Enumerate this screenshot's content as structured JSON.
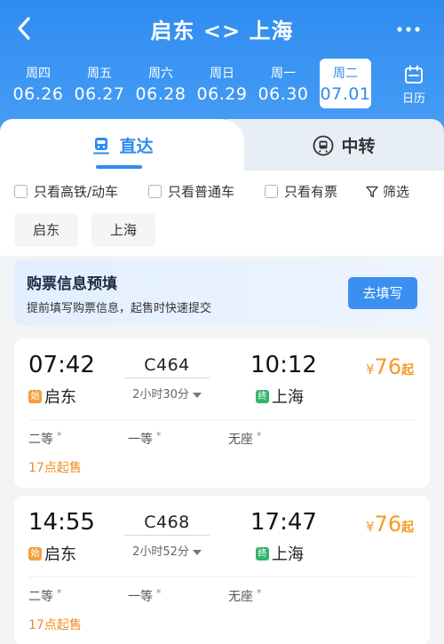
{
  "header": {
    "title": "启东 <> 上海",
    "back_icon": "back-chevron-icon",
    "more_icon": "more-dots-icon",
    "colors": {
      "primary": "#2d8cf0",
      "price": "#f59a23",
      "sale": "#f28a1a"
    }
  },
  "dates": [
    {
      "weekday": "周四",
      "date": "06.26"
    },
    {
      "weekday": "周五",
      "date": "06.27"
    },
    {
      "weekday": "周六",
      "date": "06.28"
    },
    {
      "weekday": "周日",
      "date": "06.29"
    },
    {
      "weekday": "周一",
      "date": "06.30"
    },
    {
      "weekday": "周二",
      "date": "07.01",
      "selected": true
    }
  ],
  "calendar": {
    "label": "日历",
    "icon": "calendar-icon"
  },
  "tabs": [
    {
      "label": "直达",
      "icon": "train-icon",
      "active": true
    },
    {
      "label": "中转",
      "icon": "transfer-train-icon",
      "active": false
    }
  ],
  "filters": {
    "options": [
      {
        "label": "只看高铁/动车",
        "checked": false
      },
      {
        "label": "只看普通车",
        "checked": false
      },
      {
        "label": "只看有票",
        "checked": false
      }
    ],
    "filter_label": "筛选",
    "filter_icon": "funnel-icon"
  },
  "stations": [
    "启东",
    "上海"
  ],
  "prefill": {
    "title": "购票信息预填",
    "desc": "提前填写购票信息，起售时快速提交",
    "button": "去填写"
  },
  "trains": [
    {
      "dep_time": "07:42",
      "arr_time": "10:12",
      "train_no": "C464",
      "duration": "2小时30分",
      "dep_station": "启东",
      "arr_station": "上海",
      "start_tag": "始",
      "end_tag": "终",
      "price_currency": "¥",
      "price": "76",
      "price_unit": "起",
      "seats": [
        "二等",
        "一等",
        "无座"
      ],
      "seat_mark": "*",
      "sale_time": "17点起售"
    },
    {
      "dep_time": "14:55",
      "arr_time": "17:47",
      "train_no": "C468",
      "duration": "2小时52分",
      "dep_station": "启东",
      "arr_station": "上海",
      "start_tag": "始",
      "end_tag": "终",
      "price_currency": "¥",
      "price": "76",
      "price_unit": "起",
      "seats": [
        "二等",
        "一等",
        "无座"
      ],
      "seat_mark": "*",
      "sale_time": "17点起售"
    }
  ]
}
